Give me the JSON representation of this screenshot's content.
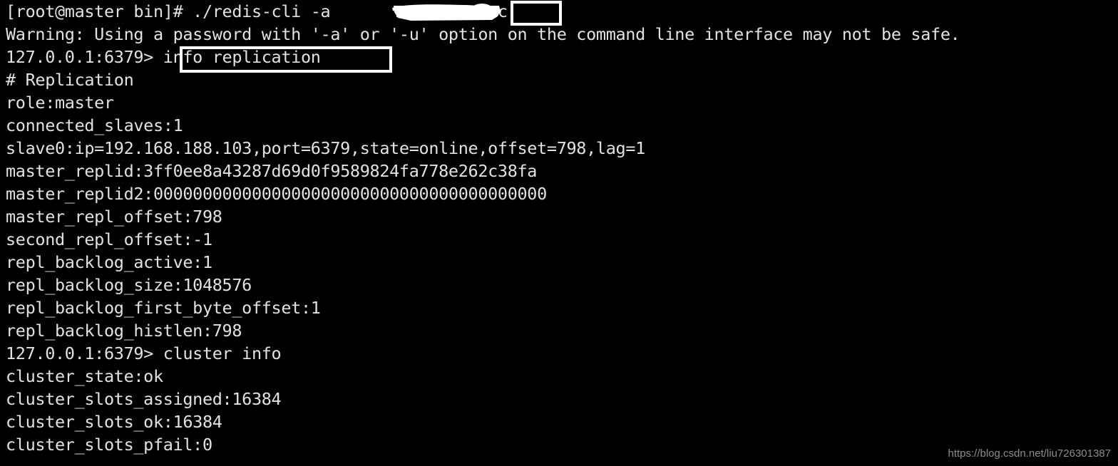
{
  "window": {
    "type": "terminal-console",
    "background_color": "#000000",
    "foreground_color": "#e2e2e2",
    "font_size_px": 23.5,
    "line_height_px": 32,
    "columns_visible": 96,
    "rows_visible": 20
  },
  "terminal": {
    "lines": [
      "[root@master bin]# ./redis-cli -a                -c",
      "Warning: Using a password with '-a' or '-u' option on the command line interface may not be safe.",
      "127.0.0.1:6379> info replication",
      "# Replication",
      "role:master",
      "connected_slaves:1",
      "slave0:ip=192.168.188.103,port=6379,state=online,offset=798,lag=1",
      "master_replid:3ff0ee8a43287d69d0f9589824fa778e262c38fa",
      "master_replid2:0000000000000000000000000000000000000000",
      "master_repl_offset:798",
      "second_repl_offset:-1",
      "repl_backlog_active:1",
      "repl_backlog_size:1048576",
      "repl_backlog_first_byte_offset:1",
      "repl_backlog_histlen:798",
      "127.0.0.1:6379> cluster info",
      "cluster_state:ok",
      "cluster_slots_assigned:16384",
      "cluster_slots_ok:16384",
      "cluster_slots_pfail:0"
    ],
    "prompt_shell": "[root@master bin]#",
    "prompt_redis": "127.0.0.1:6379>",
    "commands_entered": [
      "./redis-cli -a <redacted-password> -c",
      "info replication",
      "cluster info"
    ],
    "replication_info": {
      "section_header": "# Replication",
      "role": "master",
      "connected_slaves": "1",
      "slave0": "ip=192.168.188.103,port=6379,state=online,offset=798,lag=1",
      "master_replid": "3ff0ee8a43287d69d0f9589824fa778e262c38fa",
      "master_replid2": "0000000000000000000000000000000000000000",
      "master_repl_offset": "798",
      "second_repl_offset": "-1",
      "repl_backlog_active": "1",
      "repl_backlog_size": "1048576",
      "repl_backlog_first_byte_offset": "1",
      "repl_backlog_histlen": "798"
    },
    "cluster_info": {
      "cluster_state": "ok",
      "cluster_slots_assigned": "16384",
      "cluster_slots_ok": "16384",
      "cluster_slots_pfail": "0"
    }
  },
  "annotations": {
    "redaction": {
      "kind": "white-scribble",
      "color": "#ffffff",
      "covers": "password argument after -a"
    },
    "boxes": [
      {
        "label": "-c",
        "target": "cluster mode flag",
        "color": "#ffffff"
      },
      {
        "label": "info replication",
        "target": "redis command",
        "color": "#ffffff"
      }
    ]
  },
  "watermark": {
    "text": "https://blog.csdn.net/liu726301387",
    "color": "#8d8d8d"
  }
}
